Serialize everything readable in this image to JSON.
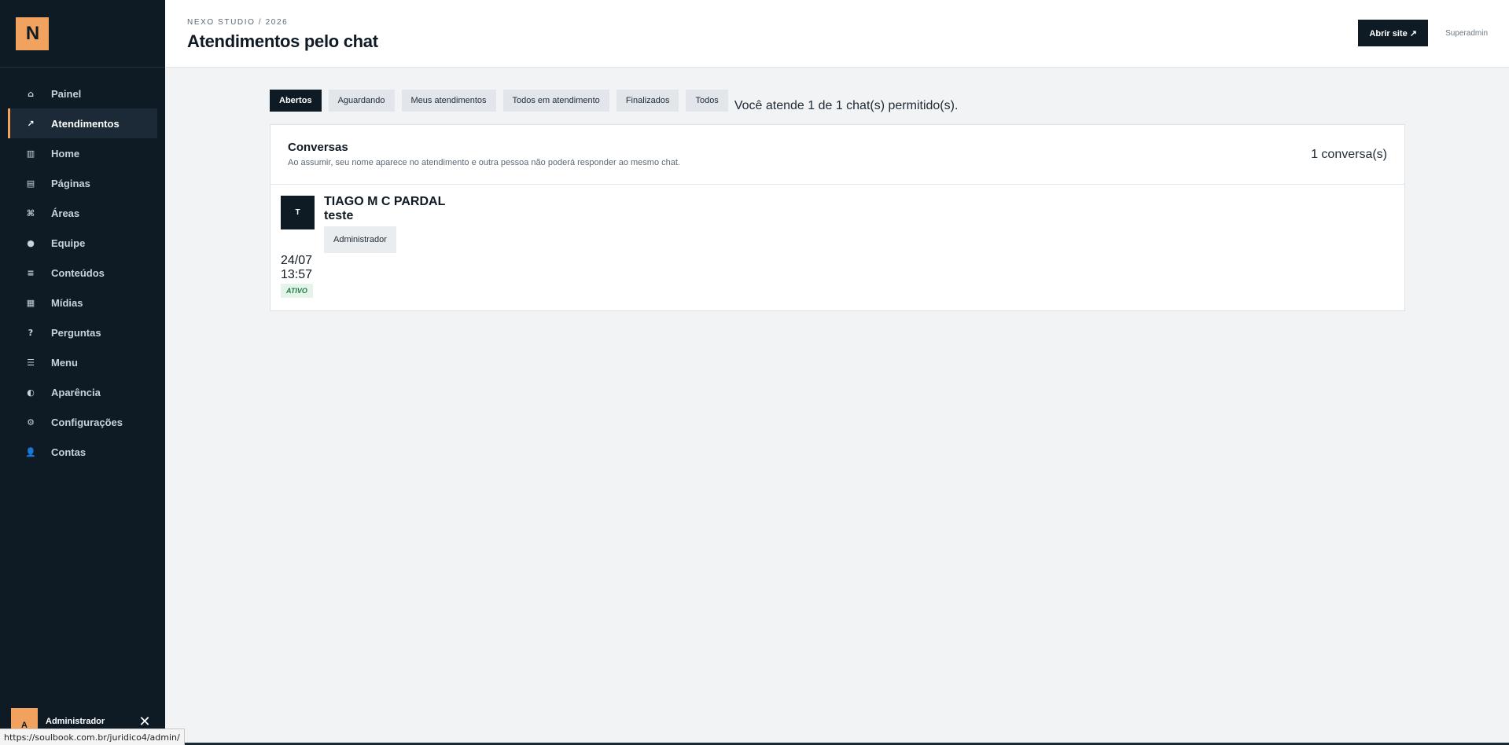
{
  "brand": {
    "logo_letter": "N",
    "accent": "#f1a25e",
    "dark": "#0e1b25"
  },
  "sidebar": {
    "items": [
      {
        "label": "Painel",
        "icon": "home-icon",
        "glyph": "⌂"
      },
      {
        "label": "Atendimentos",
        "icon": "arrow-up-right-icon",
        "glyph": "↗",
        "active": true
      },
      {
        "label": "Home",
        "icon": "columns-icon",
        "glyph": "▥"
      },
      {
        "label": "Páginas",
        "icon": "page-icon",
        "glyph": "▤"
      },
      {
        "label": "Áreas",
        "icon": "command-icon",
        "glyph": "⌘"
      },
      {
        "label": "Equipe",
        "icon": "team-icon",
        "glyph": "●"
      },
      {
        "label": "Conteúdos",
        "icon": "list-icon",
        "glyph": "≡"
      },
      {
        "label": "Mídias",
        "icon": "media-icon",
        "glyph": "▦"
      },
      {
        "label": "Perguntas",
        "icon": "question-icon",
        "glyph": "?"
      },
      {
        "label": "Menu",
        "icon": "menu-icon",
        "glyph": "☰"
      },
      {
        "label": "Aparência",
        "icon": "contrast-icon",
        "glyph": "◐"
      },
      {
        "label": "Configurações",
        "icon": "gear-icon",
        "glyph": "⚙"
      },
      {
        "label": "Contas",
        "icon": "user-icon",
        "glyph": "👤"
      }
    ],
    "user": {
      "initial": "A",
      "name": "Administrador",
      "close_glyph": "✕"
    }
  },
  "header": {
    "eyebrow": "NEXO STUDIO / 2026",
    "title": "Atendimentos pelo chat",
    "open_site_label": "Abrir site ↗",
    "role_label": "Superadmin"
  },
  "tabs": [
    {
      "label": "Abertos",
      "active": true
    },
    {
      "label": "Aguardando"
    },
    {
      "label": "Meus atendimentos"
    },
    {
      "label": "Todos em atendimento"
    },
    {
      "label": "Finalizados"
    },
    {
      "label": "Todos"
    }
  ],
  "quota_text": "Você atende 1 de 1 chat(s) permitido(s).",
  "panel": {
    "title": "Conversas",
    "subtitle": "Ao assumir, seu nome aparece no atendimento e outra pessoa não poderá responder ao mesmo chat.",
    "count": "1 conversa(s)"
  },
  "conversations": [
    {
      "initial": "T",
      "name": "TIAGO M C PARDAL",
      "message": "teste",
      "role": "Administrador",
      "date": "24/07",
      "time": "13:57",
      "status": "ATIVO"
    }
  ],
  "status_url": "https://soulbook.com.br/juridico4/admin/"
}
